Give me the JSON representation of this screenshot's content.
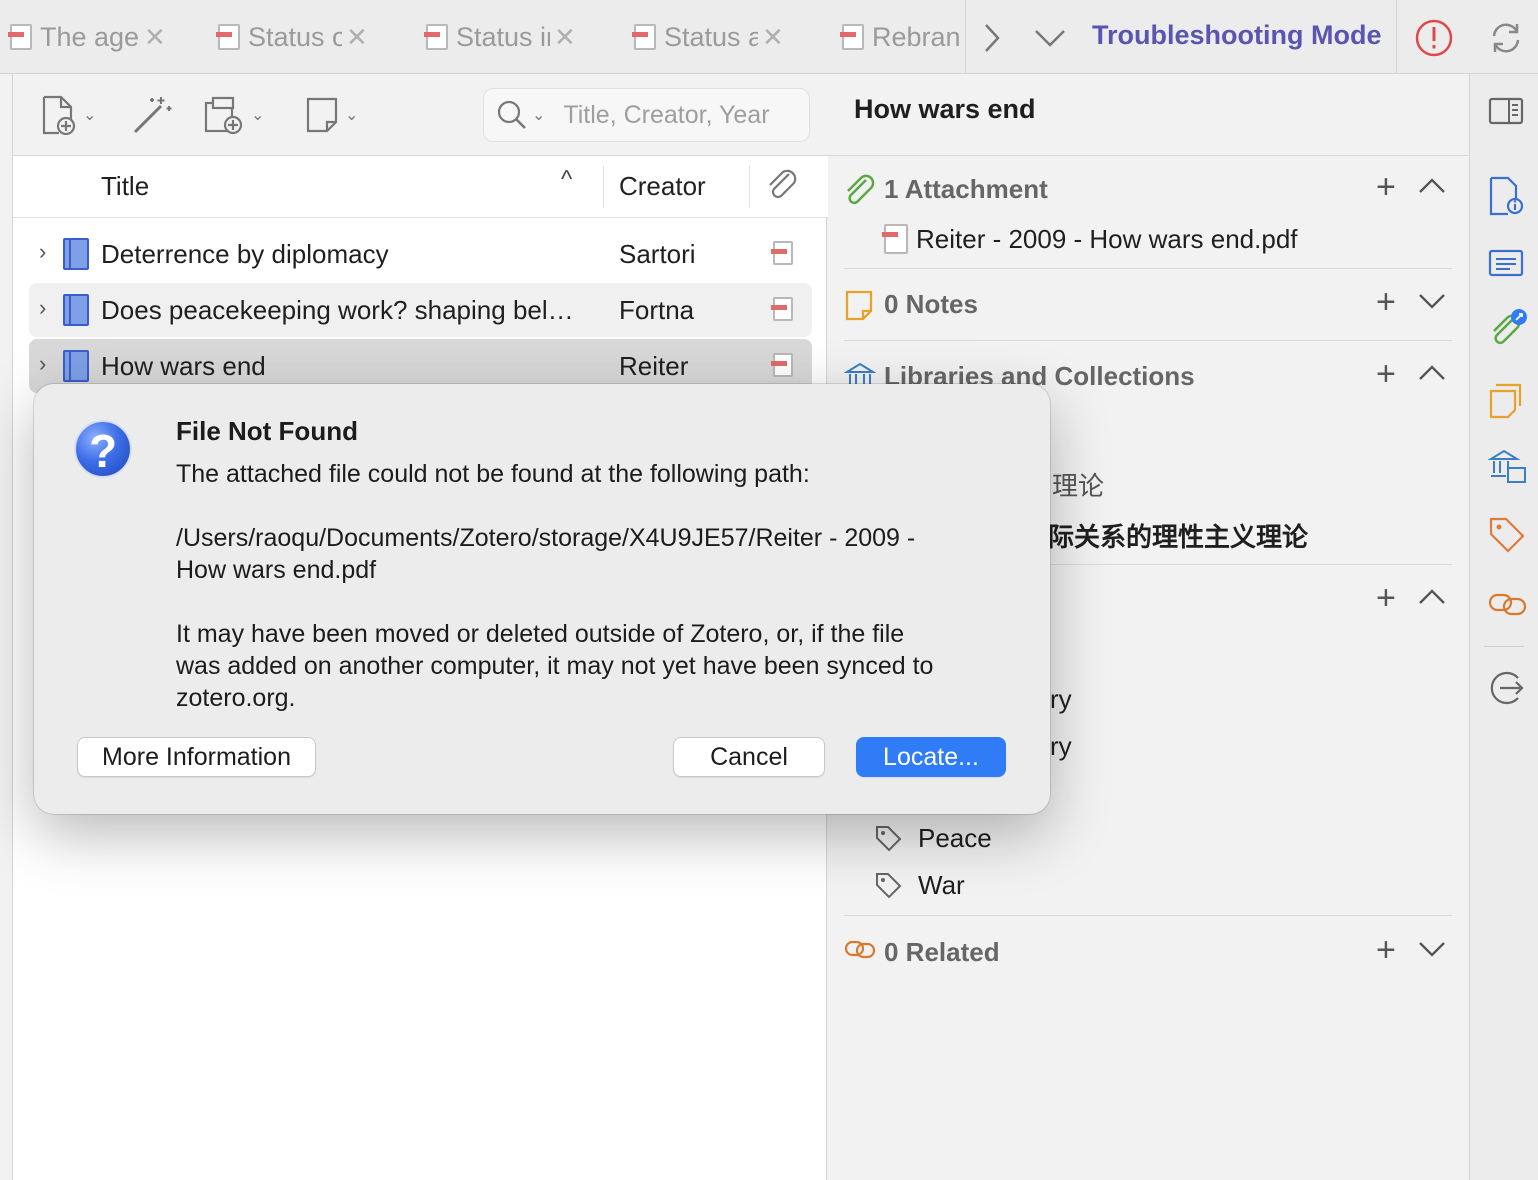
{
  "tabs": [
    {
      "label": "The agent"
    },
    {
      "label": "Status of"
    },
    {
      "label": "Status in"
    },
    {
      "label": "Status a"
    },
    {
      "label": "Rebrand"
    }
  ],
  "troubleshooting_label": "Troubleshooting Mode",
  "search": {
    "placeholder": "Title, Creator, Year"
  },
  "columns": {
    "title": "Title",
    "creator": "Creator"
  },
  "items": [
    {
      "title": "Deterrence by diplomacy",
      "creator": "Sartori"
    },
    {
      "title": "Does peacekeeping work? shaping bel…",
      "creator": "Fortna"
    },
    {
      "title": "How wars end",
      "creator": "Reiter"
    }
  ],
  "right_pane": {
    "title": "How wars end",
    "attachments": {
      "label": "1 Attachment",
      "file": "Reiter - 2009 - How wars end.pdf"
    },
    "notes": {
      "label": "0 Notes"
    },
    "libraries": {
      "label": "Libraries and Collections",
      "partial_1": "理论",
      "partial_2": "际关系的理性主义理论"
    },
    "partial_items": [
      "ry",
      "ry"
    ],
    "tags": [
      "Peace",
      "War"
    ],
    "related": {
      "label": "0 Related"
    }
  },
  "dialog": {
    "title": "File Not Found",
    "line1": "The attached file could not be found at the following path:",
    "path_line1": "/Users/raoqu/Documents/Zotero/storage/X4U9JE57/Reiter - 2009 -",
    "path_line2": "How wars end.pdf",
    "msg_line1": "It may have been moved or deleted outside of Zotero, or, if the file",
    "msg_line2": "was added on another computer, it may not yet have been synced to",
    "msg_line3": "zotero.org.",
    "more_info": "More Information",
    "cancel": "Cancel",
    "locate": "Locate..."
  },
  "colors": {
    "accent": "#2f7cf6",
    "troubleshooting": "#5a55b0",
    "book": "#3a5ec8"
  }
}
